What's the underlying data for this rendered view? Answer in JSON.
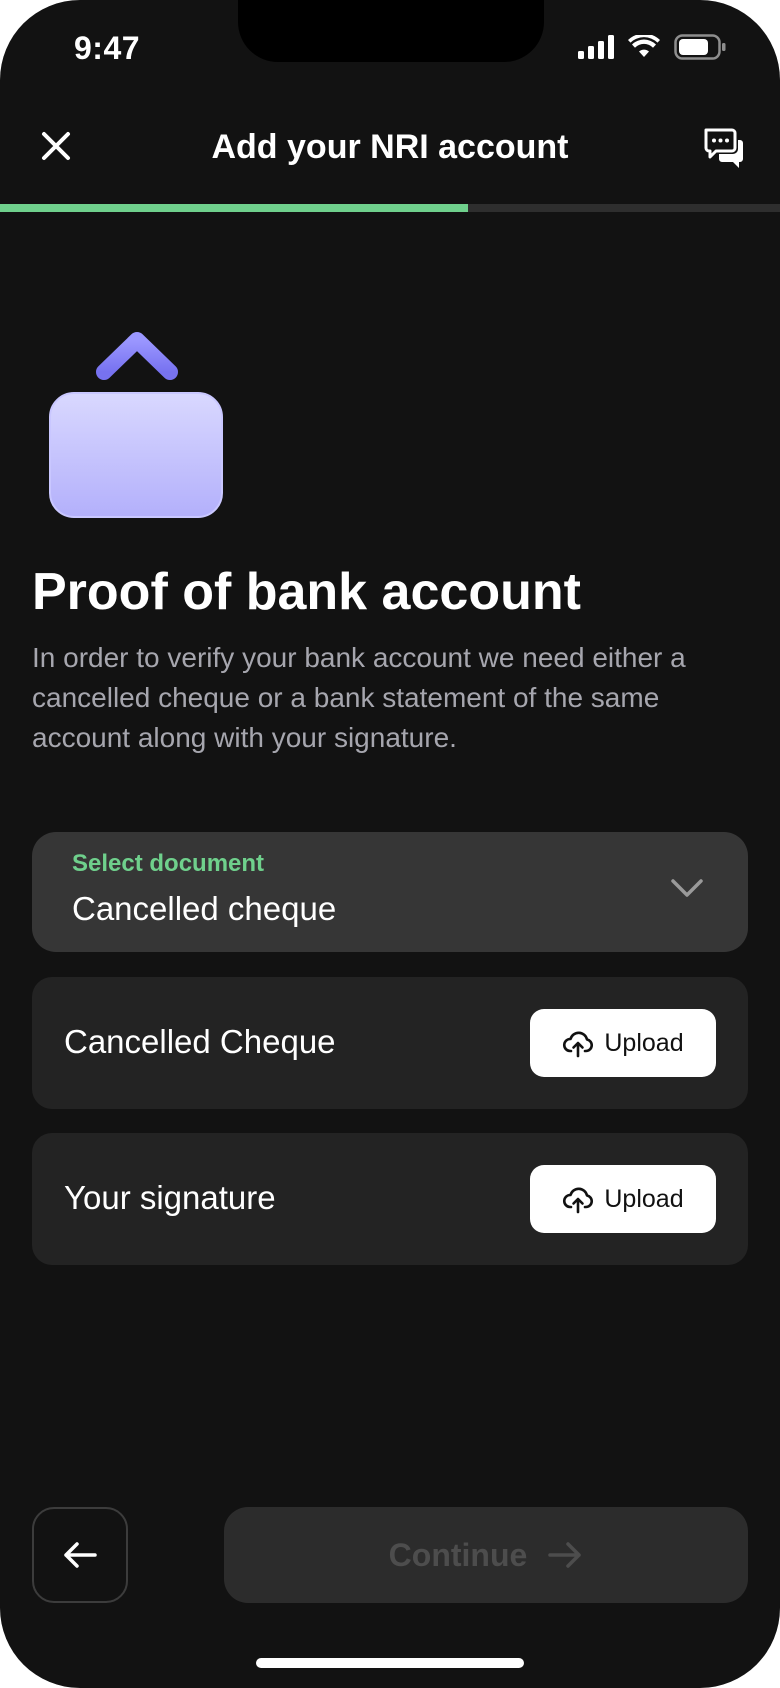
{
  "status_bar": {
    "time": "9:47"
  },
  "header": {
    "title": "Add your NRI account",
    "close_icon": "close-icon",
    "chat_icon": "chat-icon"
  },
  "progress": {
    "fraction": 0.6
  },
  "hero": {
    "icon": "upload-box-icon"
  },
  "content": {
    "title": "Proof of bank account",
    "description": "In order to verify your bank account we need either a cancelled cheque or a bank statement of the same account along with your signature."
  },
  "document_select": {
    "label": "Select document",
    "value": "Cancelled cheque"
  },
  "uploads": [
    {
      "label": "Cancelled Cheque",
      "button": "Upload"
    },
    {
      "label": "Your signature",
      "button": "Upload"
    }
  ],
  "footer": {
    "continue_label": "Continue"
  },
  "colors": {
    "accent": "#6fd08c",
    "background": "#121212",
    "card": "#363636",
    "row": "#232323",
    "hero_purple": "#8a85f5"
  }
}
